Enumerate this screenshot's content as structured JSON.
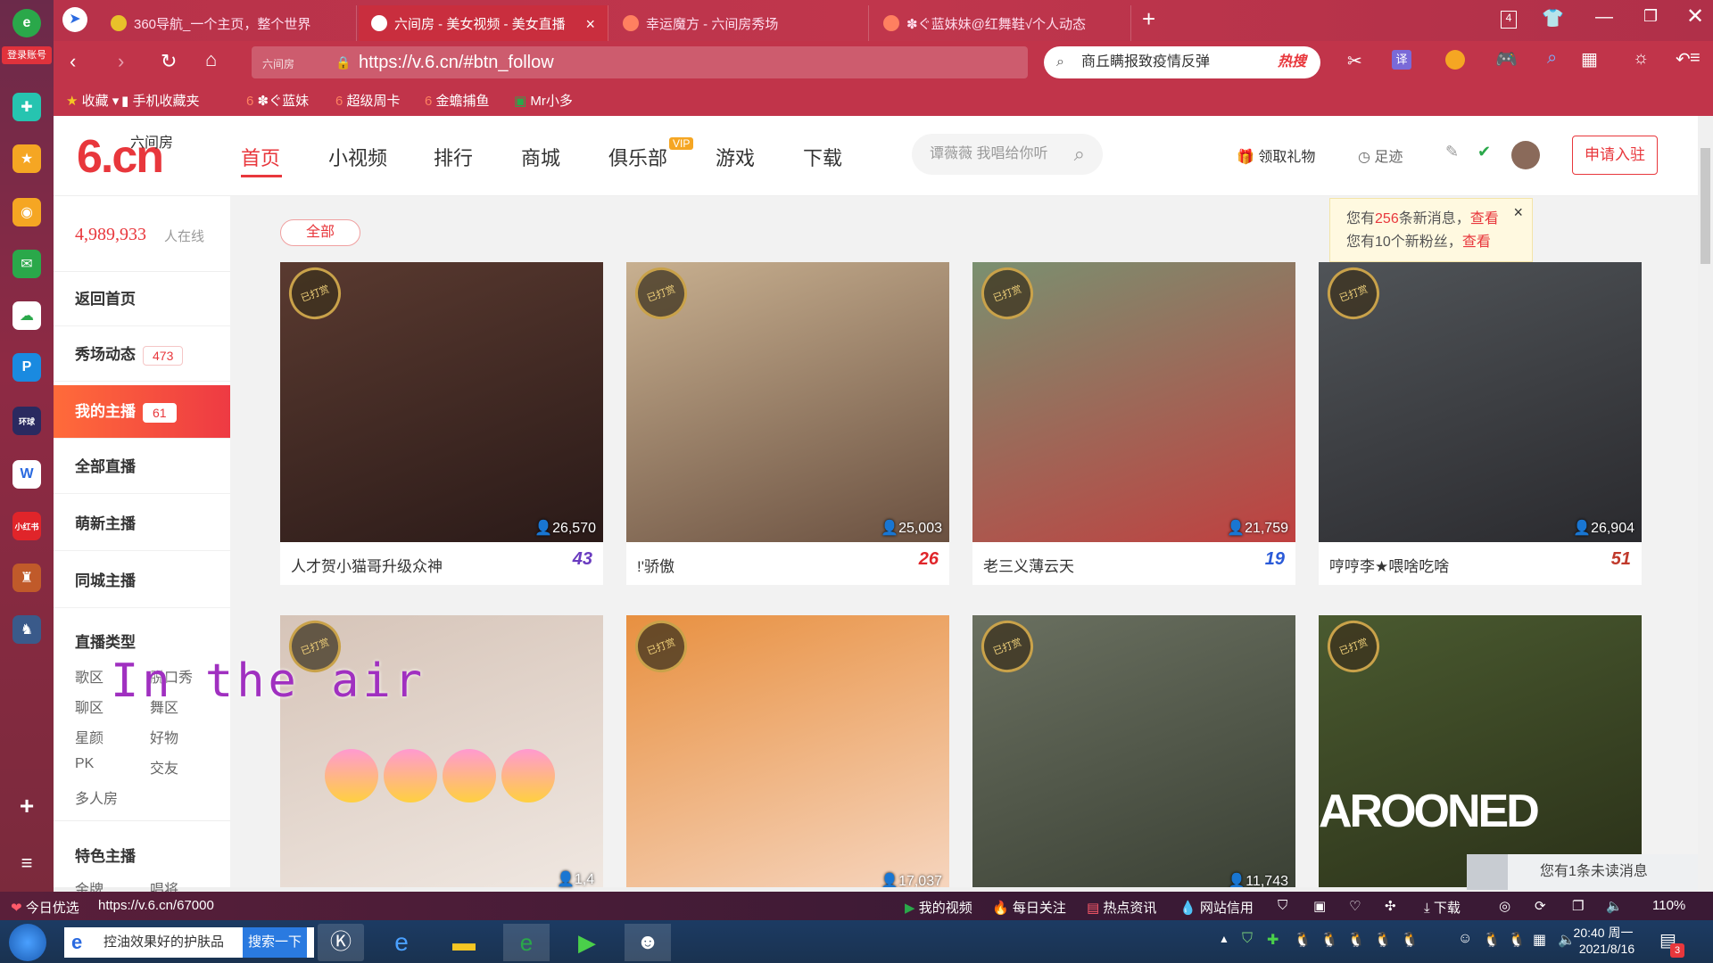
{
  "rail": {
    "login": "登录账号",
    "plus": "+",
    "list": "≡"
  },
  "tabs": [
    {
      "label": "360导航_一个主页，整个世界",
      "fav": "#e8c12a"
    },
    {
      "label": "六间房 - 美女视频 - 美女直播",
      "fav": "#ffffff"
    },
    {
      "label": "幸运魔方 - 六间房秀场",
      "fav": "#ff8060"
    },
    {
      "label": "✽ぐ蓝妹妹@红舞鞋√个人动态",
      "fav": "#ff8060"
    }
  ],
  "tab_close": "×",
  "tab_add": "+",
  "window_counter": "4",
  "address": {
    "url": "https://v.6.cn/#btn_follow",
    "prefix": "六间房",
    "search": "商丘瞒报致疫情反弹",
    "hot": "热搜",
    "translate": "译"
  },
  "bookmarks": [
    "收藏",
    "手机收藏夹",
    "✽ぐ蓝妹",
    "超级周卡",
    "金蟾捕鱼",
    "Mr小多"
  ],
  "site": {
    "logo_big": "6.cn",
    "logo_small": "六间房",
    "nav": [
      "首页",
      "小视频",
      "排行",
      "商城",
      "俱乐部",
      "游戏",
      "下载"
    ],
    "vip": "VIP",
    "search_placeholder": "谭薇薇 我唱给你听",
    "gift": "领取礼物",
    "footprint": "足迹",
    "apply": "申请入驻"
  },
  "sidebar": {
    "online_count": "4,989,933",
    "online_label": "人在线",
    "items": [
      {
        "label": "返回首页",
        "badge": ""
      },
      {
        "label": "秀场动态",
        "badge": "473"
      },
      {
        "label": "我的主播",
        "badge": "61"
      },
      {
        "label": "全部直播",
        "badge": ""
      },
      {
        "label": "萌新主播",
        "badge": ""
      },
      {
        "label": "同城主播",
        "badge": ""
      }
    ],
    "type_title": "直播类型",
    "types": [
      "歌区",
      "脱口秀",
      "聊区",
      "舞区",
      "星颜",
      "好物",
      "PK",
      "交友",
      "多人房"
    ],
    "special_title": "特色主播",
    "special_partial": [
      "金牌",
      "唱将"
    ]
  },
  "content": {
    "filter": "全部",
    "stamp": "已打赏",
    "cards": [
      {
        "name": "人才贺小猫哥升级众神",
        "views": "26,570",
        "level": "43",
        "level_color": "#6a3cc0",
        "bg": [
          "#5a3a30",
          "#2a1a18"
        ]
      },
      {
        "name": "!'骄傲",
        "views": "25,003",
        "level": "26",
        "level_color": "#e0252a",
        "bg": [
          "#c8b090",
          "#6a5040"
        ]
      },
      {
        "name": "老三义薄云天",
        "views": "21,759",
        "level": "19",
        "level_color": "#2a5ad8",
        "bg": [
          "#7a9070",
          "#c04040"
        ]
      },
      {
        "name": "哼哼李★喂啥吃啥",
        "views": "26,904",
        "level": "51",
        "level_color": "#c0392b",
        "bg": [
          "#505458",
          "#2a2a2e"
        ]
      },
      {
        "name": "",
        "views": "",
        "level": "",
        "level_color": "#333",
        "bg": [
          "#d6c4b8",
          "#f0e8e2"
        ]
      },
      {
        "name": "",
        "views": "17,037",
        "level": "",
        "level_color": "#333",
        "bg": [
          "#e89040",
          "#f6d6c0"
        ]
      },
      {
        "name": "",
        "views": "11,743",
        "level": "",
        "level_color": "#333",
        "bg": [
          "#6a7060",
          "#3a4034"
        ]
      },
      {
        "name": "",
        "views": "",
        "level": "",
        "level_color": "#333",
        "bg": [
          "#4a5a30",
          "#2a3018"
        ]
      }
    ],
    "overlay_text": "In the air",
    "overlay_partial_views": "1,4",
    "marooned": "AROONED"
  },
  "notice": {
    "line1_pre": "您有",
    "line1_num": "256",
    "line1_mid": "条新消息，",
    "line1_link": "查看",
    "line2_pre": "您有10个新粉丝，",
    "line2_link": "查看",
    "close": "×"
  },
  "unread": "您有1条未读消息",
  "statusbar": {
    "left": "今日优选",
    "url": "https://v.6.cn/67000",
    "items": [
      "我的视频",
      "每日关注",
      "热点资讯",
      "网站信用",
      "下载"
    ],
    "zoom": "110%"
  },
  "taskbar": {
    "search": "控油效果好的护肤品",
    "search_btn": "搜索一下",
    "time": "20:40 周一",
    "date": "2021/8/16",
    "notif": "3"
  }
}
